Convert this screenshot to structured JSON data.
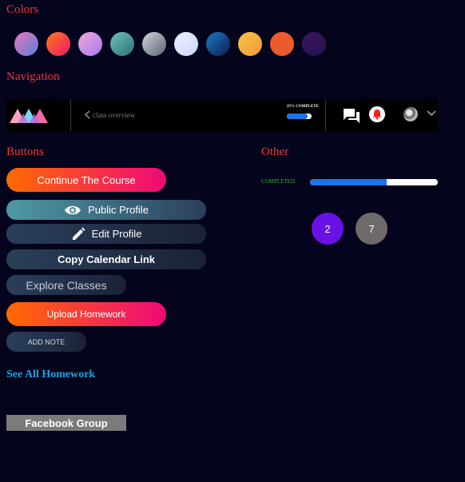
{
  "sections": {
    "colors": "Colors",
    "navigation": "Navigation",
    "buttons": "Buttons",
    "other": "Other"
  },
  "swatches": [
    {
      "name": "pink-blue",
      "from": "#e879c0",
      "to": "#5a7ed6"
    },
    {
      "name": "orange-red",
      "from": "#ff7a18",
      "to": "#f0166e"
    },
    {
      "name": "lilac",
      "from": "#f4a5d8",
      "to": "#a27cf0"
    },
    {
      "name": "teal",
      "from": "#6cc4b8",
      "to": "#2f6e78"
    },
    {
      "name": "gray",
      "from": "#d3d6db",
      "to": "#596170"
    },
    {
      "name": "ice",
      "from": "#eef3ff",
      "to": "#c9d6ff"
    },
    {
      "name": "blue",
      "from": "#1f7ac6",
      "to": "#0a1f4d"
    },
    {
      "name": "gold",
      "from": "#f7c44a",
      "to": "#f29b38"
    },
    {
      "name": "flame",
      "from": "#f0582e",
      "to": "#e75e2c"
    },
    {
      "name": "plum",
      "from": "#3a1760",
      "to": "#25124a"
    }
  ],
  "nav": {
    "back_label": "class overview",
    "progress_label": "25% COMPLETE",
    "progress_value": 0.85,
    "logo_colors": [
      "#f7a4c2",
      "#7ad7f0",
      "#f46aa0"
    ]
  },
  "buttons": {
    "continue": "Continue The Course",
    "public_profile": "Public Profile",
    "edit_profile": "Edit Profile",
    "copy_calendar": "Copy Calendar Link",
    "explore": "Explore Classes",
    "upload": "Upload Homework",
    "add_note": "ADD NOTE",
    "see_all": "See All Homework",
    "facebook": "Facebook Group"
  },
  "other": {
    "completed_label": "COMPLETED",
    "completed_value": 0.6,
    "pages": [
      "2",
      "7"
    ],
    "page_colors": [
      "#6a11e6",
      "#6e6a6a"
    ]
  }
}
